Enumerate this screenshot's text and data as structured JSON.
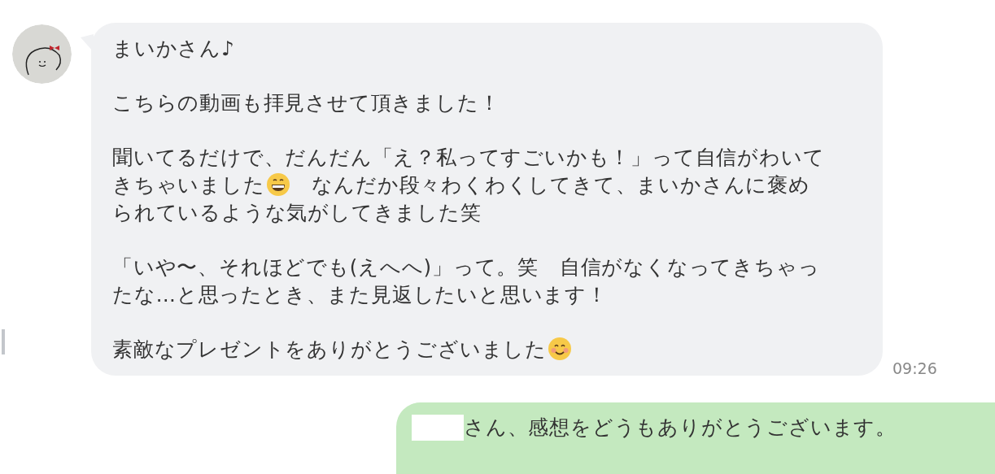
{
  "incoming": {
    "paragraphs": [
      {
        "lines": [
          [
            {
              "kind": "text",
              "text": "まいかさん♪"
            }
          ]
        ]
      },
      {
        "lines": [
          [
            {
              "kind": "text",
              "text": "こちらの動画も拝見させて頂きました！"
            }
          ]
        ]
      },
      {
        "lines": [
          [
            {
              "kind": "text",
              "text": "聞いてるだけで、だんだん「え？私ってすごいかも！」って自信がわいて"
            }
          ],
          [
            {
              "kind": "text",
              "text": "きちゃいました"
            },
            {
              "kind": "grin"
            },
            {
              "kind": "text",
              "text": "　なんだか段々わくわくしてきて、まいかさんに褒め"
            }
          ],
          [
            {
              "kind": "text",
              "text": "られているような気がしてきました笑"
            }
          ]
        ]
      },
      {
        "lines": [
          [
            {
              "kind": "text",
              "text": "「いや〜、それほどでも(えへへ)」って。笑　自信がなくなってきちゃっ"
            }
          ],
          [
            {
              "kind": "text",
              "text": "たな…と思ったとき、また見返したいと思います！"
            }
          ]
        ]
      },
      {
        "lines": [
          [
            {
              "kind": "text",
              "text": "素敵なプレゼントをありがとうございました"
            },
            {
              "kind": "smile"
            }
          ]
        ]
      }
    ],
    "time": "09:26"
  },
  "outgoing": {
    "text": "さん、感想をどうもありがとうございます。"
  }
}
